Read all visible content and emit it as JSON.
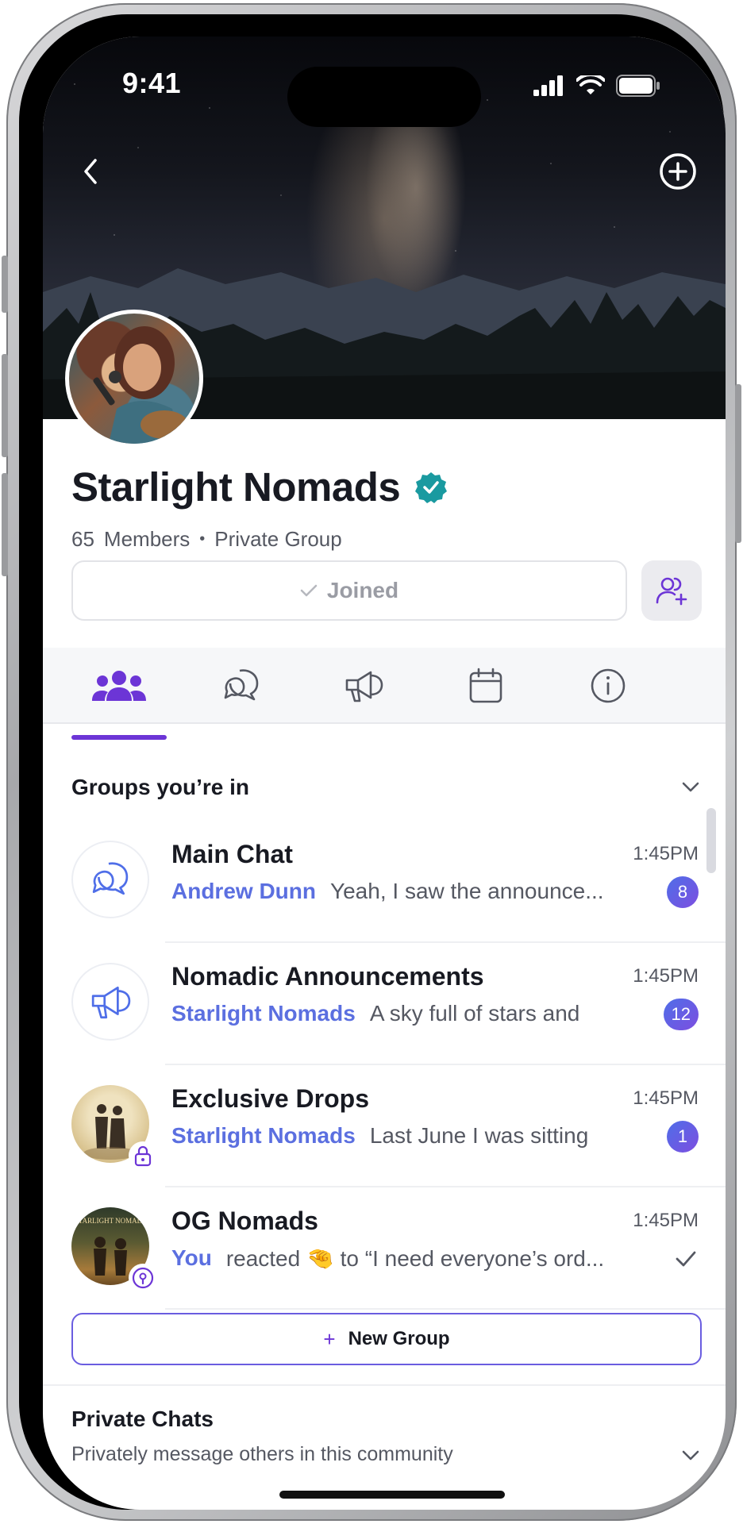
{
  "status_bar": {
    "time": "9:41"
  },
  "nav": {
    "back_icon": "chevron-left-icon",
    "add_icon": "plus-circle-icon"
  },
  "group": {
    "name": "Starlight Nomads",
    "verified": true,
    "members_count": "65",
    "members_label": "Members",
    "separator": "•",
    "privacy": "Private Group"
  },
  "actions": {
    "joined_label": "Joined",
    "invite_icon": "add-member-icon"
  },
  "tabs": [
    {
      "icon": "members-icon",
      "active": true
    },
    {
      "icon": "chat-bubbles-icon",
      "active": false
    },
    {
      "icon": "megaphone-icon",
      "active": false
    },
    {
      "icon": "calendar-icon",
      "active": false
    },
    {
      "icon": "info-icon",
      "active": false
    }
  ],
  "groups_section": {
    "title": "Groups you’re  in"
  },
  "chats": [
    {
      "name": "Main Chat",
      "time": "1:45PM",
      "sender": "Andrew Dunn",
      "message": "Yeah, I saw the announce...",
      "unread": "8"
    },
    {
      "name": "Nomadic Announcements",
      "time": "1:45PM",
      "sender": "Starlight Nomads",
      "message": "A sky full of stars and",
      "unread": "12"
    },
    {
      "name": "Exclusive Drops",
      "time": "1:45PM",
      "sender": "Starlight Nomads",
      "message": "Last June I was sitting",
      "unread": "1"
    },
    {
      "name": "OG Nomads",
      "time": "1:45PM",
      "sender": "You",
      "message": "reacted 🤏 to “I need everyone’s ord...",
      "read": true
    }
  ],
  "og_cover_text": "STARLIGHT NOMADS",
  "new_group": {
    "plus": "+",
    "label": "New Group"
  },
  "private_chats": {
    "title": "Private Chats",
    "subtitle": "Privately message others in this community"
  },
  "colors": {
    "accent": "#6c35d6",
    "sender": "#5b6fe0",
    "badge_start": "#4f6ee8",
    "badge_end": "#7d4ee0",
    "verified": "#1a9aa0"
  }
}
